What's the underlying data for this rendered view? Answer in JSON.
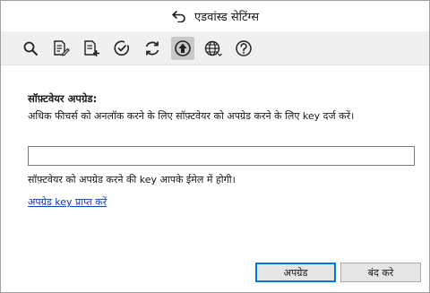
{
  "window": {
    "title": "एडवांस्ड सेटिंग्स",
    "back_icon": "back-arrow-icon"
  },
  "toolbar": {
    "items": [
      {
        "icon": "search-icon",
        "active": false
      },
      {
        "icon": "document-edit-icon",
        "active": false
      },
      {
        "icon": "document-add-icon",
        "active": false
      },
      {
        "icon": "check-circle-icon",
        "active": false
      },
      {
        "icon": "sync-icon",
        "active": false
      },
      {
        "icon": "upgrade-icon",
        "active": true
      },
      {
        "icon": "globe-icon",
        "active": false
      },
      {
        "icon": "help-icon",
        "active": false
      }
    ]
  },
  "upgrade": {
    "heading": "सॉफ़्टवेयर अपग्रेड:",
    "description": "अधिक फीचर्स को अनलॉक करने के लिए सॉफ़्टवेयर को अपग्रेड करने के लिए key दर्ज करें।",
    "key_value": "",
    "key_placeholder": "",
    "note": "सॉफ़्टवेयर को अपग्रेड करने की key आपके ईमेल में होगी।",
    "get_key_link": "अपग्रेड key प्राप्त करें"
  },
  "buttons": {
    "upgrade": "अपग्रेड",
    "close": "बंद करे"
  },
  "colors": {
    "toolbar_bg": "#f0f0f0",
    "active_button_bg": "#c9c9c9",
    "link": "#0645ad",
    "primary_border": "#0078d7"
  }
}
